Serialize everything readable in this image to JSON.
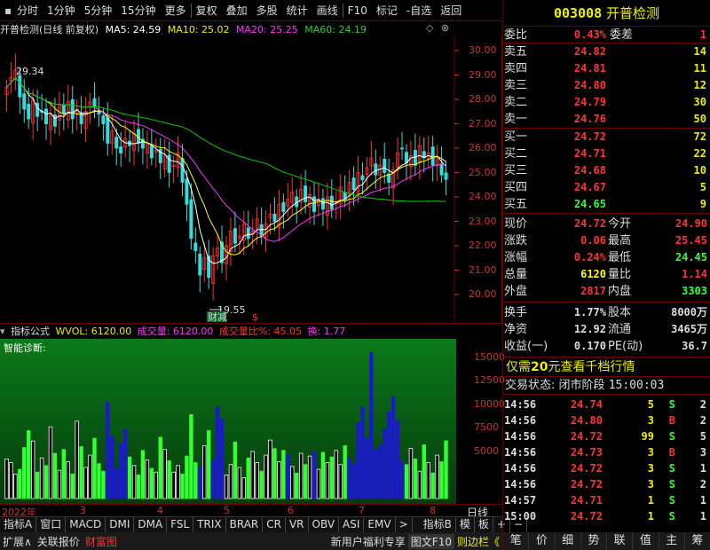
{
  "toolbar": {
    "items": [
      "分时",
      "1分钟",
      "5分钟",
      "15分钟",
      "更多",
      "复权",
      "叠加",
      "多股",
      "统计",
      "画线",
      "F10",
      "标记",
      "-自选",
      "返回"
    ]
  },
  "chart": {
    "title": "开普检测(日线 前复权)",
    "ma5": "MA5: 24.59",
    "ma10": "MA10: 25.02",
    "ma20": "MA20: 25.25",
    "ma60": "MA60: 24.19",
    "high_label": "29.34",
    "low_label": "19.55",
    "event_label": "财减",
    "event_mark": "$",
    "y_ticks": [
      "30.00",
      "29.00",
      "28.00",
      "27.00",
      "26.00",
      "25.00",
      "24.00",
      "23.00",
      "22.00",
      "21.00",
      "20.00"
    ],
    "colors": {
      "up": "#ff3333",
      "down": "#33dddd",
      "ma5": "#ffffff",
      "ma10": "#ffff00",
      "ma20": "#ff33ff",
      "ma60": "#00cc00"
    }
  },
  "volume": {
    "indicator": "指标公式",
    "wvol": "WVOL: 6120.00",
    "chengjiao": "成交量: 6120.00",
    "ratio": "成交量比%: 45.05",
    "huan": "换: 1.77",
    "diagnosis": "智能诊断:",
    "y_ticks": [
      "15000",
      "12500",
      "10000",
      "7500",
      "5000"
    ]
  },
  "dates": [
    "2022年",
    "3",
    "4",
    "5",
    "6",
    "7",
    "8"
  ],
  "right_scale_label": "日线",
  "tabs": [
    "指标A",
    "窗口",
    "MACD",
    "DMI",
    "DMA",
    "FSL",
    "TRIX",
    "BRAR",
    "CR",
    "VR",
    "OBV",
    "ASI",
    "EMV",
    ">",
    "指标B",
    "模",
    "板"
  ],
  "tab_icons": [
    "+",
    "−"
  ],
  "bottom": {
    "left": [
      "扩展∧",
      "关联报价",
      "财富图"
    ],
    "right": [
      "新用户福利专享",
      "图文F10",
      "则边栏《"
    ]
  },
  "stock": {
    "code": "003008",
    "name": "开普检测"
  },
  "weibi": {
    "label1": "委比",
    "val1": "0.43%",
    "label2": "委差",
    "val2": "1"
  },
  "sells": [
    {
      "label": "卖五",
      "price": "24.82",
      "vol": "14"
    },
    {
      "label": "卖四",
      "price": "24.81",
      "vol": "11"
    },
    {
      "label": "卖三",
      "price": "24.80",
      "vol": "12"
    },
    {
      "label": "卖二",
      "price": "24.79",
      "vol": "30"
    },
    {
      "label": "卖一",
      "price": "24.76",
      "vol": "50"
    }
  ],
  "buys": [
    {
      "label": "买一",
      "price": "24.72",
      "vol": "72"
    },
    {
      "label": "买二",
      "price": "24.71",
      "vol": "22"
    },
    {
      "label": "买三",
      "price": "24.68",
      "vol": "10"
    },
    {
      "label": "买四",
      "price": "24.67",
      "vol": "5"
    },
    {
      "label": "买五",
      "price": "24.65",
      "vol": "9"
    }
  ],
  "quote": [
    {
      "l1": "现价",
      "v1": "24.72",
      "c1": "#ff3333",
      "l2": "今开",
      "v2": "24.90",
      "c2": "#ff3333"
    },
    {
      "l1": "涨跌",
      "v1": "0.06",
      "c1": "#ff3333",
      "l2": "最高",
      "v2": "25.45",
      "c2": "#ff3333"
    },
    {
      "l1": "涨幅",
      "v1": "0.24%",
      "c1": "#ff3333",
      "l2": "最低",
      "v2": "24.45",
      "c2": "#33ff33"
    },
    {
      "l1": "总量",
      "v1": "6120",
      "c1": "#ffff00",
      "l2": "量比",
      "v2": "1.14",
      "c2": "#ff3333"
    },
    {
      "l1": "外盘",
      "v1": "2817",
      "c1": "#ff3333",
      "l2": "内盘",
      "v2": "3303",
      "c2": "#33ff33"
    }
  ],
  "quote2": [
    {
      "l1": "换手",
      "v1": "1.77%",
      "l2": "股本",
      "v2": "8000万"
    },
    {
      "l1": "净资",
      "v1": "12.92",
      "l2": "流通",
      "v2": "3465万"
    },
    {
      "l1": "收益(一)",
      "v1": "0.170",
      "l2": "PE(动)",
      "v2": "36.7"
    }
  ],
  "promo": {
    "a": "仅需",
    "b": "20",
    "c": "元查看千档行情"
  },
  "status": {
    "label": "交易状态:",
    "state": "闭市阶段",
    "time": "15:00:03"
  },
  "trades": [
    {
      "t": "14:56",
      "p": "24.74",
      "v": "5",
      "d": "S",
      "n": "2"
    },
    {
      "t": "14:56",
      "p": "24.80",
      "v": "3",
      "d": "B",
      "n": "2"
    },
    {
      "t": "14:56",
      "p": "24.72",
      "v": "99",
      "d": "S",
      "n": "5"
    },
    {
      "t": "14:56",
      "p": "24.73",
      "v": "3",
      "d": "B",
      "n": "3"
    },
    {
      "t": "14:56",
      "p": "24.72",
      "v": "3",
      "d": "S",
      "n": "1"
    },
    {
      "t": "14:56",
      "p": "24.72",
      "v": "3",
      "d": "S",
      "n": "2"
    },
    {
      "t": "14:57",
      "p": "24.71",
      "v": "1",
      "d": "S",
      "n": "1"
    },
    {
      "t": "15:00",
      "p": "24.72",
      "v": "1",
      "d": "S",
      "n": "1"
    }
  ],
  "right_tabs": [
    "笔",
    "价",
    "细",
    "势",
    "联",
    "值",
    "主",
    "筹"
  ]
}
